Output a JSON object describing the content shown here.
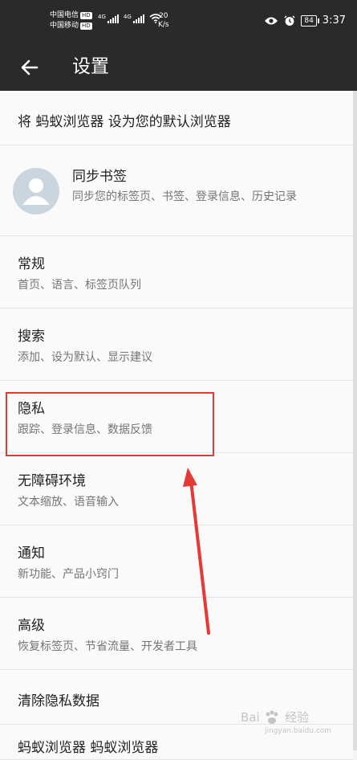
{
  "status": {
    "carrier1": "中国电信",
    "carrier2": "中国移动",
    "hd_badge": "HD",
    "network1": "4G",
    "network2": "4G",
    "speed_value": "20",
    "speed_unit": "K/s",
    "battery": "84",
    "time": "3:37"
  },
  "appbar": {
    "title": "设置"
  },
  "default_browser": {
    "title": "将 蚂蚁浏览器 设为您的默认浏览器"
  },
  "sync": {
    "title": "同步书签",
    "subtitle": "同步您的标签页、书签、登录信息、历史记录"
  },
  "items": [
    {
      "title": "常规",
      "subtitle": "首页、语言、标签页队列"
    },
    {
      "title": "搜索",
      "subtitle": "添加、设为默认、显示建议"
    },
    {
      "title": "隐私",
      "subtitle": "跟踪、登录信息、数据反馈"
    },
    {
      "title": "无障碍环境",
      "subtitle": "文本缩放、语音输入"
    },
    {
      "title": "通知",
      "subtitle": "新功能、产品小窍门"
    },
    {
      "title": "高级",
      "subtitle": "恢复标签页、节省流量、开发者工具"
    }
  ],
  "clear_data": {
    "title": "清除隐私数据"
  },
  "partial_item": {
    "title": "蚂蚁浏览器 蚂蚁浏览器"
  },
  "watermark": {
    "brand": "Bai",
    "brand2": "经验",
    "url": "jingyan.baidu.com"
  },
  "colors": {
    "bar": "#2a2a2a",
    "highlight": "#e53935",
    "background": "#fafafa"
  }
}
